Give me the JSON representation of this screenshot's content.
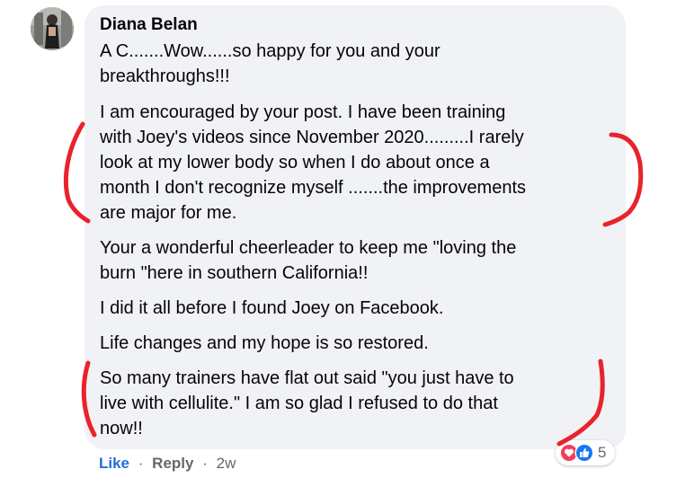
{
  "comment": {
    "author": "Diana Belan",
    "paragraphs": [
      [
        "A C.......Wow......so happy for you and your",
        "breakthroughs!!!"
      ],
      [
        "I am encouraged by your post. I have been training",
        "with Joey's videos since November 2020.........I rarely",
        "look at my lower body so when I do about once a",
        "month I don't recognize myself .......the improvements",
        "are major for me."
      ],
      [
        "Your a wonderful cheerleader to keep me \"loving the",
        "burn \"here in southern California!!"
      ],
      [
        "I did it all before I found Joey on Facebook."
      ],
      [
        "Life changes and my hope is so restored."
      ],
      [
        "So many trainers have flat out said \"you just have to",
        "live with cellulite.\" I am so glad I refused to do that",
        "now!!"
      ]
    ]
  },
  "actions": {
    "like_label": "Like",
    "separator": "·",
    "reply_label": "Reply",
    "time": "2w"
  },
  "reactions": {
    "icons": [
      "love-icon",
      "like-icon"
    ],
    "count": "5"
  },
  "colors": {
    "bubble": "#f0f2f5",
    "like_blue": "#216fdb",
    "meta_gray": "#65676b",
    "annotation_red": "#e8232b",
    "love_red": "#f33e58"
  }
}
